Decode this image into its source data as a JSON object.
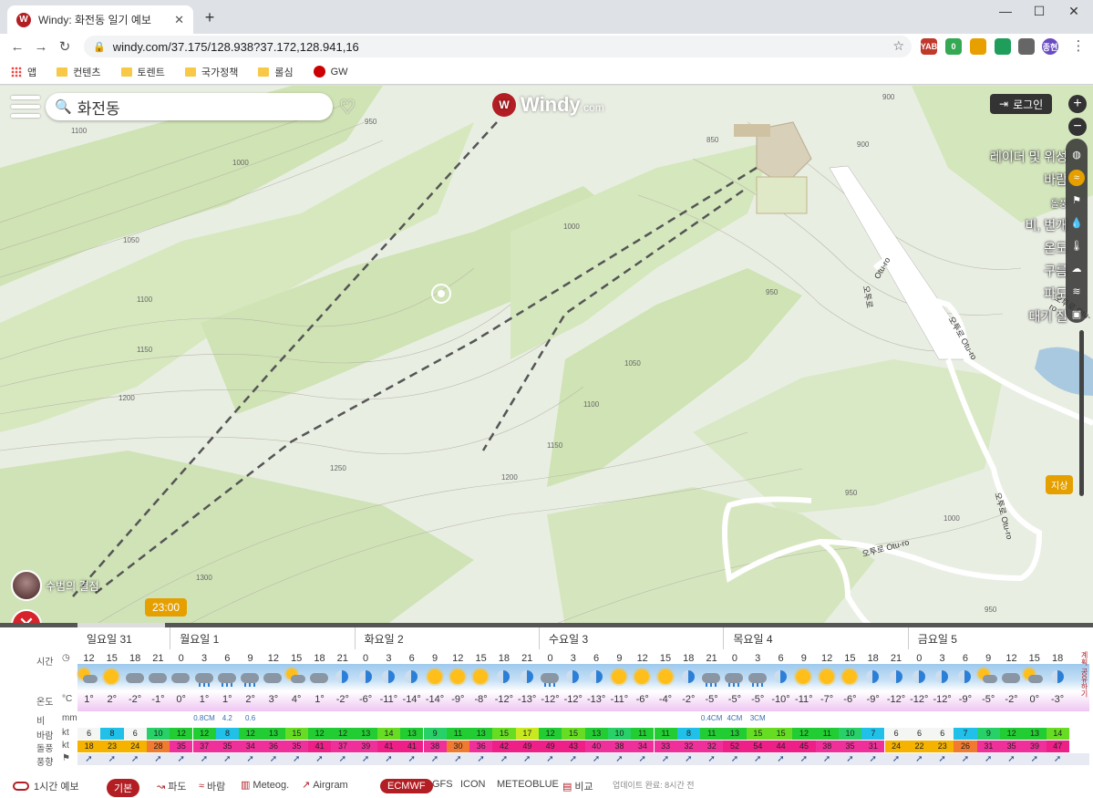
{
  "browser": {
    "tab_title": "Windy: 화전동 일기 예보",
    "url": "windy.com/37.175/128.938?37.172,128.941,16",
    "bookmarks": [
      "앱",
      "컨텐츠",
      "토렌트",
      "국가정책",
      "롤심",
      "GW"
    ],
    "ext_labels": [
      "YAB",
      "0",
      "",
      "",
      "",
      "종현"
    ]
  },
  "map": {
    "search_value": "화전동",
    "logo_text": "Windy",
    "logo_suffix": ".com",
    "login_label": "로그인",
    "layers": [
      "레이더 및 위성",
      "바람",
      "돌풍",
      "비, 번개",
      "온도",
      "구름",
      "파도",
      "대기 질"
    ],
    "active_layer": "바람",
    "ground_label": "지상",
    "webcam_label": "수범의 결점",
    "time_label": "23:00",
    "road_labels": [
      "Otu-ro",
      "오투로",
      "오투로 Otu-ro",
      "오투로 Otu-ro",
      "오투로 Otu-ro",
      "오투로 Otu-ro"
    ],
    "contour_labels": [
      "1100",
      "1050",
      "1000",
      "950",
      "1100",
      "1150",
      "1200",
      "1250",
      "1300",
      "1050",
      "1100",
      "1150",
      "1200",
      "1000",
      "950",
      "900",
      "850",
      "900",
      "950",
      "1000",
      "950"
    ]
  },
  "forecast": {
    "days": [
      "일요일 31",
      "월요일 1",
      "화요일 2",
      "수요일 3",
      "목요일 4",
      "금요일 5"
    ],
    "row_labels": {
      "time": "시간",
      "temp": "온도",
      "rain": "비",
      "wind": "바람",
      "gust": "돌풍",
      "dir": "풍향"
    },
    "units": {
      "temp": "°C",
      "rain": "mm",
      "wind": "kt",
      "gust": "kt"
    },
    "hours": [
      "12",
      "15",
      "18",
      "21",
      "0",
      "3",
      "6",
      "9",
      "12",
      "15",
      "18",
      "21",
      "0",
      "3",
      "6",
      "9",
      "12",
      "15",
      "18",
      "21",
      "0",
      "3",
      "6",
      "9",
      "12",
      "15",
      "18",
      "21",
      "0",
      "3",
      "6",
      "9",
      "12",
      "15",
      "18",
      "21",
      "0",
      "3",
      "6",
      "9",
      "12",
      "15",
      "18"
    ],
    "weather": [
      "psun",
      "sun",
      "cloud",
      "cloud",
      "cloud",
      "rainy",
      "rainy",
      "rainy",
      "cloud",
      "psun",
      "cloud",
      "moon",
      "moon",
      "moon",
      "moon",
      "sun",
      "sun",
      "sun",
      "moon",
      "moon",
      "rainy",
      "moon",
      "moon",
      "sun",
      "sun",
      "sun",
      "moon",
      "rainy",
      "rainy",
      "rainy",
      "moon",
      "sun",
      "sun",
      "sun",
      "moon",
      "moon",
      "moon",
      "moon",
      "moon",
      "psun",
      "cloud",
      "psun",
      "moon"
    ],
    "temps": [
      "1°",
      "2°",
      "-2°",
      "-1°",
      "0°",
      "1°",
      "1°",
      "2°",
      "3°",
      "4°",
      "1°",
      "-2°",
      "-6°",
      "-11°",
      "-14°",
      "-14°",
      "-9°",
      "-8°",
      "-12°",
      "-13°",
      "-12°",
      "-12°",
      "-13°",
      "-11°",
      "-6°",
      "-4°",
      "-2°",
      "-5°",
      "-5°",
      "-5°",
      "-10°",
      "-11°",
      "-7°",
      "-6°",
      "-9°",
      "-12°",
      "-12°",
      "-12°",
      "-9°",
      "-5°",
      "-2°",
      "0°",
      "-3°"
    ],
    "rain": [
      "",
      "",
      "",
      "",
      "",
      "0.8CM",
      "4.2",
      "0.6",
      "",
      "",
      "",
      "",
      "",
      "",
      "",
      "",
      "",
      "",
      "",
      "",
      "",
      "",
      "",
      "",
      "",
      "",
      "",
      "0.4CM",
      "4CM",
      "3CM",
      "",
      "",
      "",
      "",
      "",
      "",
      "",
      "",
      "",
      "",
      "",
      "",
      ""
    ],
    "wind": [
      6,
      8,
      6,
      10,
      12,
      12,
      8,
      12,
      13,
      15,
      12,
      12,
      13,
      14,
      13,
      9,
      11,
      13,
      15,
      17,
      12,
      15,
      13,
      10,
      11,
      11,
      8,
      11,
      13,
      15,
      15,
      12,
      11,
      10,
      7,
      6,
      6,
      6,
      7,
      9,
      12,
      13,
      14
    ],
    "gust": [
      18,
      23,
      24,
      28,
      35,
      37,
      35,
      34,
      36,
      35,
      41,
      37,
      39,
      41,
      41,
      38,
      30,
      36,
      42,
      49,
      49,
      43,
      40,
      38,
      34,
      33,
      32,
      32,
      52,
      54,
      44,
      45,
      38,
      35,
      31,
      24,
      22,
      23,
      26,
      31,
      35,
      39,
      47
    ],
    "bottom": {
      "hourly_label": "1시간 예보",
      "tabs": [
        "기본",
        "파도",
        "바람",
        "Meteog.",
        "Airgram"
      ],
      "models": [
        "ECMWF",
        "GFS",
        "ICON",
        "METEOBLUE",
        "비교"
      ],
      "update_note": "업데이트 완료: 8시간 전"
    },
    "side_text": "계획 공유하기"
  },
  "colors": {
    "brand": "#b21e23",
    "accent": "#e5a000",
    "map_bg": "#e8eee0"
  }
}
